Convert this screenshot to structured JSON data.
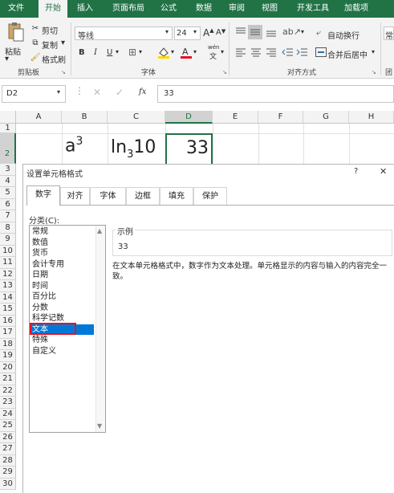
{
  "ribbon_tabs": [
    "文件",
    "开始",
    "插入",
    "页面布局",
    "公式",
    "数据",
    "审阅",
    "视图",
    "开发工具",
    "加载项"
  ],
  "clipboard": {
    "paste": "粘贴",
    "cut": "剪切",
    "copy": "复制",
    "copy_arrow": "▾",
    "format_painter": "格式刷",
    "group_label": "剪贴板"
  },
  "font": {
    "name": "等线",
    "size": "24",
    "bold": "B",
    "italic": "I",
    "underline": "U",
    "grow": "A",
    "shrink": "A",
    "phonetic": "wén",
    "group_label": "字体"
  },
  "alignment": {
    "wrap_text": "自动换行",
    "merge_center": "合并后居中",
    "merge_arrow": "▾",
    "group_label": "对齐方式"
  },
  "number_group_partial": "常",
  "edge_group_partial": "团",
  "formula_bar": {
    "name_box": "D2",
    "fx": "fx",
    "value": "33"
  },
  "columns": [
    "A",
    "B",
    "C",
    "D",
    "E",
    "F",
    "G",
    "H"
  ],
  "rows": [
    "1",
    "2",
    "3",
    "4",
    "5",
    "6",
    "7",
    "8",
    "9",
    "10",
    "11",
    "12",
    "13",
    "14",
    "15",
    "16",
    "17",
    "18",
    "19",
    "20",
    "21",
    "22",
    "23",
    "24",
    "25",
    "26",
    "27",
    "28",
    "29",
    "30"
  ],
  "cells": {
    "b2_base": "a",
    "b2_exp": "3",
    "c2_pre": "ln",
    "c2_sub": "3",
    "c2_post": "10",
    "d2": "33"
  },
  "dialog": {
    "title": "设置单元格格式",
    "help": "?",
    "close": "✕",
    "tabs": [
      "数字",
      "对齐",
      "字体",
      "边框",
      "填充",
      "保护"
    ],
    "category_label": "分类(C):",
    "categories": [
      "常规",
      "数值",
      "货币",
      "会计专用",
      "日期",
      "时间",
      "百分比",
      "分数",
      "科学记数",
      "文本",
      "特殊",
      "自定义"
    ],
    "selected_category": "文本",
    "sample_label": "示例",
    "sample_value": "33",
    "description": "在文本单元格格式中，数字作为文本处理。单元格显示的内容与输入的内容完全一致。"
  },
  "colors": {
    "excel_green": "#217346",
    "selection_blue": "#0078d7",
    "highlight_red": "#e81123"
  }
}
